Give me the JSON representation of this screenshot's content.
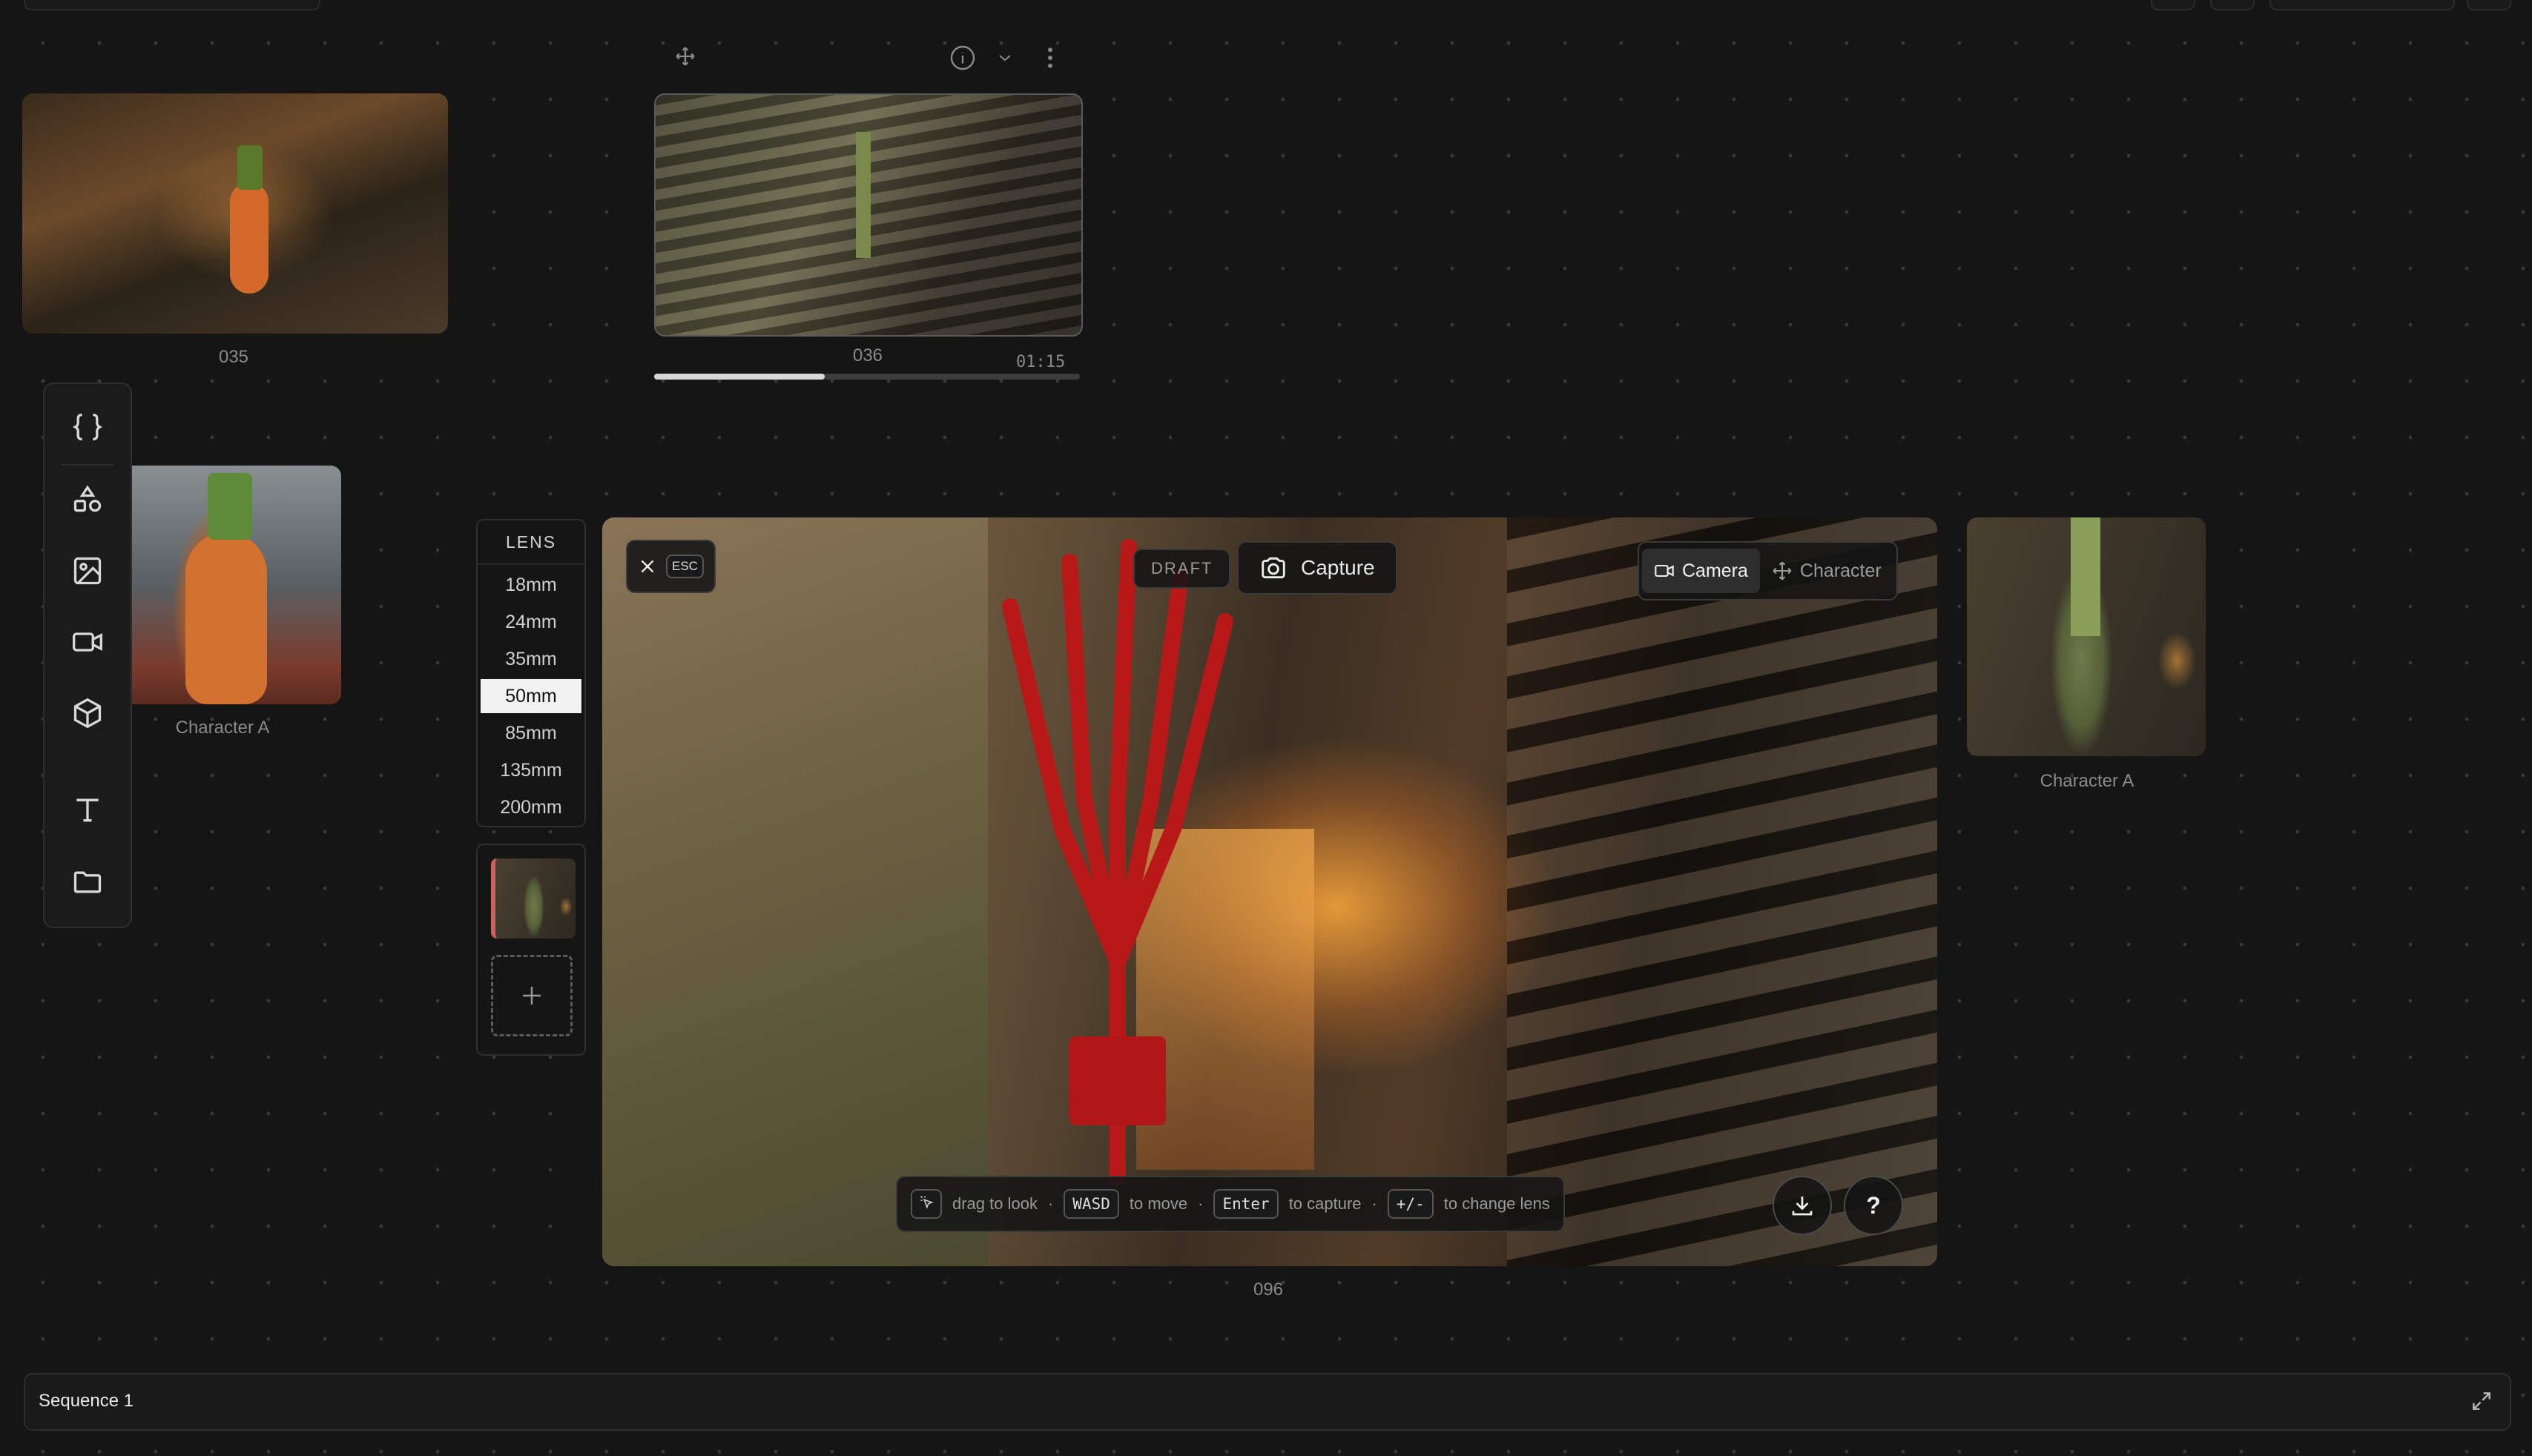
{
  "canvas": {
    "thumbnails": [
      {
        "id": "thumb-035",
        "label": "035"
      },
      {
        "id": "thumb-036",
        "label": "036",
        "duration": "01:15",
        "progress": 0.4
      },
      {
        "id": "thumb-character-left",
        "label": "Character A"
      },
      {
        "id": "thumb-character-right",
        "label": "Character A"
      }
    ]
  },
  "toolbar": {
    "tools": [
      {
        "name": "code-icon"
      },
      {
        "name": "shapes-icon"
      },
      {
        "name": "image-icon"
      },
      {
        "name": "video-icon"
      },
      {
        "name": "cube-icon"
      },
      {
        "name": "text-icon"
      },
      {
        "name": "folder-icon"
      }
    ]
  },
  "lens": {
    "title": "LENS",
    "options": [
      "18mm",
      "24mm",
      "35mm",
      "50mm",
      "85mm",
      "135mm",
      "200mm"
    ],
    "selected": "50mm"
  },
  "viewport": {
    "label": "096",
    "esc_label": "ESC",
    "draft_label": "DRAFT",
    "capture_label": "Capture",
    "modes": {
      "camera": "Camera",
      "character": "Character",
      "active": "Camera"
    },
    "hints": {
      "drag": "drag to look",
      "move_key": "WASD",
      "move": "to move",
      "capture_key": "Enter",
      "capture": "to capture",
      "lens_key": "+/-",
      "lens": "to change lens"
    },
    "help_label": "?"
  },
  "sequence": {
    "title": "Sequence 1"
  }
}
